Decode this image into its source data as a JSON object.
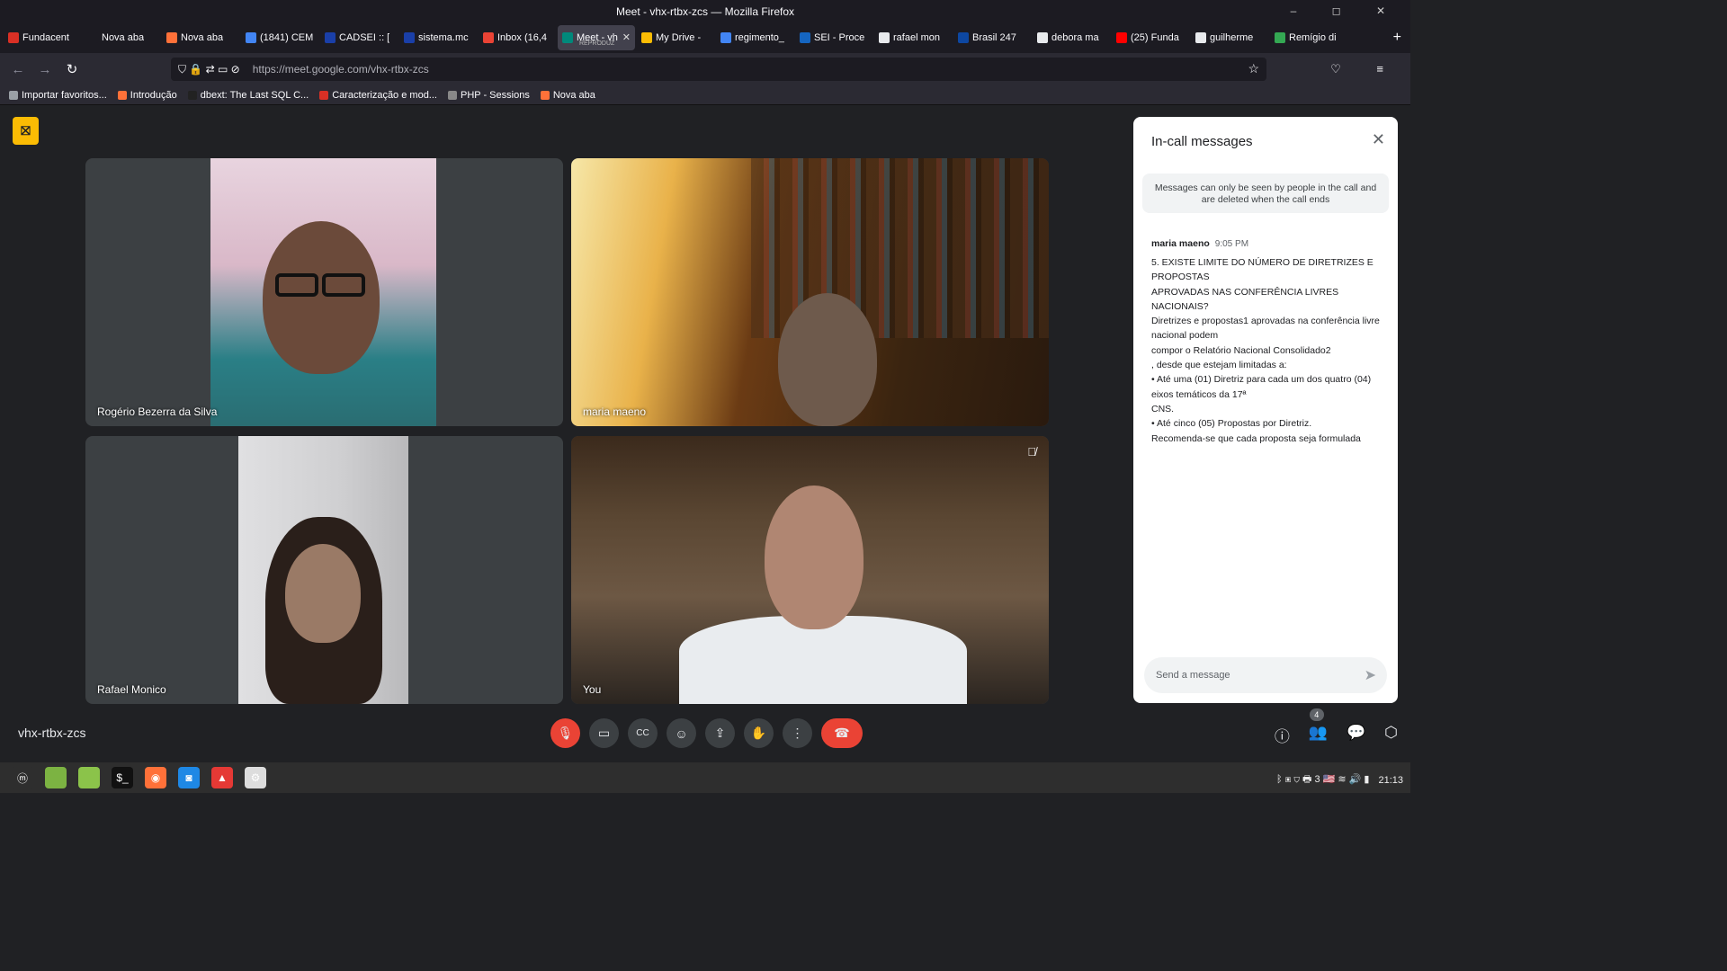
{
  "window": {
    "title": "Meet - vhx-rtbx-zcs — Mozilla Firefox",
    "controls": "– ◻ ✕"
  },
  "tabs": [
    {
      "label": "Fundacent",
      "color": "#d93025",
      "active": false
    },
    {
      "label": "Nova aba",
      "color": "#1c1b22",
      "active": false
    },
    {
      "label": "Nova aba",
      "color": "#ff7139",
      "active": false
    },
    {
      "label": "(1841) CEM",
      "color": "#4285f4",
      "active": false
    },
    {
      "label": "CADSEI :: [",
      "color": "#1a3fa8",
      "active": false
    },
    {
      "label": "sistema.mc",
      "color": "#1a3fa8",
      "active": false
    },
    {
      "label": "Inbox (16,4",
      "color": "#ea4335",
      "active": false
    },
    {
      "label": "Meet - vh",
      "sub": "REPRODUZ",
      "color": "#00897b",
      "active": true
    },
    {
      "label": "My Drive -",
      "color": "#fbbc04",
      "active": false
    },
    {
      "label": "regimento_",
      "color": "#4285f4",
      "active": false
    },
    {
      "label": "SEI - Proce",
      "color": "#1565c0",
      "active": false
    },
    {
      "label": "rafael mon",
      "color": "#e8eaed",
      "active": false
    },
    {
      "label": "Brasil 247",
      "color": "#0d47a1",
      "active": false
    },
    {
      "label": "debora ma",
      "color": "#e8eaed",
      "active": false
    },
    {
      "label": "(25) Funda",
      "color": "#ff0000",
      "active": false
    },
    {
      "label": "guilherme",
      "color": "#e8eaed",
      "active": false
    },
    {
      "label": "Remígio di",
      "color": "#34a853",
      "active": false
    }
  ],
  "tab_close": "✕",
  "newtab": "+",
  "nav": {
    "back": "←",
    "forward": "→",
    "reload": "↻",
    "url": "https://meet.google.com/vhx-rtbx-zcs",
    "star": "☆",
    "menu": "♡ ≡",
    "icons": "⛉ 🔒 ⇄ ▭ ⊘"
  },
  "bookmarks": [
    {
      "label": "Importar favoritos...",
      "color": "#9aa0a6"
    },
    {
      "label": "Introdução",
      "color": "#ff7139"
    },
    {
      "label": "dbext: The Last SQL C...",
      "color": "#222"
    },
    {
      "label": "Caracterização e mod...",
      "color": "#d93025"
    },
    {
      "label": "PHP - Sessions",
      "color": "#888"
    },
    {
      "label": "Nova aba",
      "color": "#ff7139"
    }
  ],
  "meet": {
    "rec_icon": "⛝",
    "participants": [
      {
        "name": "Rogério Bezerra da Silva"
      },
      {
        "name": "maria maeno"
      },
      {
        "name": "Rafael Monico"
      },
      {
        "name": "You",
        "muted_icon": "🎙̸"
      }
    ],
    "code": "vhx-rtbx-zcs",
    "controls": {
      "mic": "🎙",
      "cam": "▭",
      "captions": "CC",
      "emoji": "☺",
      "present": "⇪",
      "hand": "✋",
      "more": "⋮",
      "end": "☎"
    },
    "right": {
      "info": "ⓘ",
      "people": "👥",
      "people_count": "4",
      "chat": "💬",
      "activities": "⬡"
    }
  },
  "panel": {
    "title": "In-call messages",
    "close": "✕",
    "notice": "Messages can only be seen by people in the call and are deleted when the call ends",
    "sender": "maria maeno",
    "time": "9:05 PM",
    "lines": [
      "5. EXISTE LIMITE DO NÚMERO DE DIRETRIZES E PROPOSTAS",
      "APROVADAS NAS CONFERÊNCIA LIVRES NACIONAIS?",
      "Diretrizes e propostas1 aprovadas na conferência livre nacional podem",
      "compor o Relatório Nacional Consolidado2",
      ", desde que estejam limitadas a:",
      "• Até uma (01) Diretriz para cada um dos quatro (04) eixos temáticos da 17ª",
      "CNS.",
      "• Até cinco (05) Propostas por Diretriz.",
      "Recomenda-se que cada proposta seja formulada"
    ],
    "input_placeholder": "Send a message",
    "send": "➤"
  },
  "taskbar": {
    "icons": [
      {
        "name": "menu",
        "glyph": "ⓜ",
        "color": "#2e2e2e"
      },
      {
        "name": "files",
        "glyph": "",
        "color": "#7cb342"
      },
      {
        "name": "folder",
        "glyph": "",
        "color": "#8bc34a"
      },
      {
        "name": "terminal",
        "glyph": "$_",
        "color": "#111"
      },
      {
        "name": "firefox",
        "glyph": "◉",
        "color": "#ff7139"
      },
      {
        "name": "camera",
        "glyph": "◙",
        "color": "#1e88e5"
      },
      {
        "name": "image",
        "glyph": "▲",
        "color": "#e53935"
      },
      {
        "name": "settings",
        "glyph": "⚙",
        "color": "#ddd"
      }
    ],
    "tray": "ᛒ ▣ ⛉ 🖶 3 🇺🇸 ≋ 🔊 ▮",
    "clock": "21:13"
  }
}
